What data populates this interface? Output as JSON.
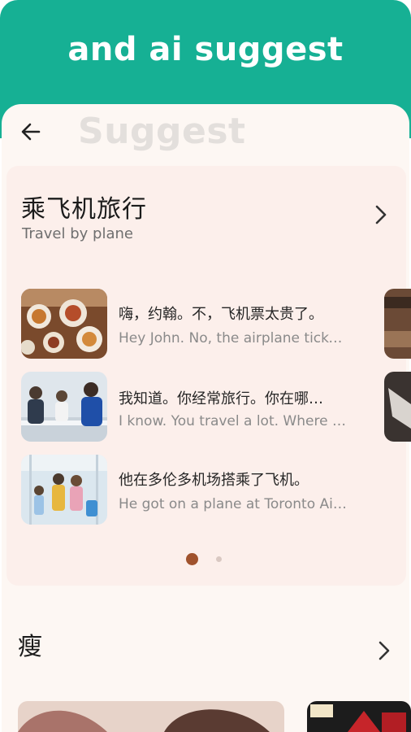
{
  "header": {
    "title": "and ai suggest"
  },
  "page": {
    "ghost_title": "Suggest"
  },
  "lesson": {
    "title": "乘飞机旅行",
    "subtitle": "Travel by plane",
    "items": [
      {
        "cn": "嗨，约翰。不，飞机票太贵了。",
        "en": "Hey John. No, the airplane ticke…"
      },
      {
        "cn": "我知道。你经常旅行。你在哪…",
        "en": "I know. You travel a lot. Where d…"
      },
      {
        "cn": "他在多伦多机场搭乘了飞机。",
        "en": "He got on a plane at Toronto Air…"
      }
    ]
  },
  "section2": {
    "title": "瘦"
  },
  "icons": {
    "back": "arrow-left-icon",
    "chevron": "chevron-right-icon"
  },
  "colors": {
    "header": "#16b094",
    "sheet": "#fdf7f3",
    "card": "#fcefeb",
    "active_dot": "#a0522d",
    "inactive_dot": "#d9c8c2"
  }
}
